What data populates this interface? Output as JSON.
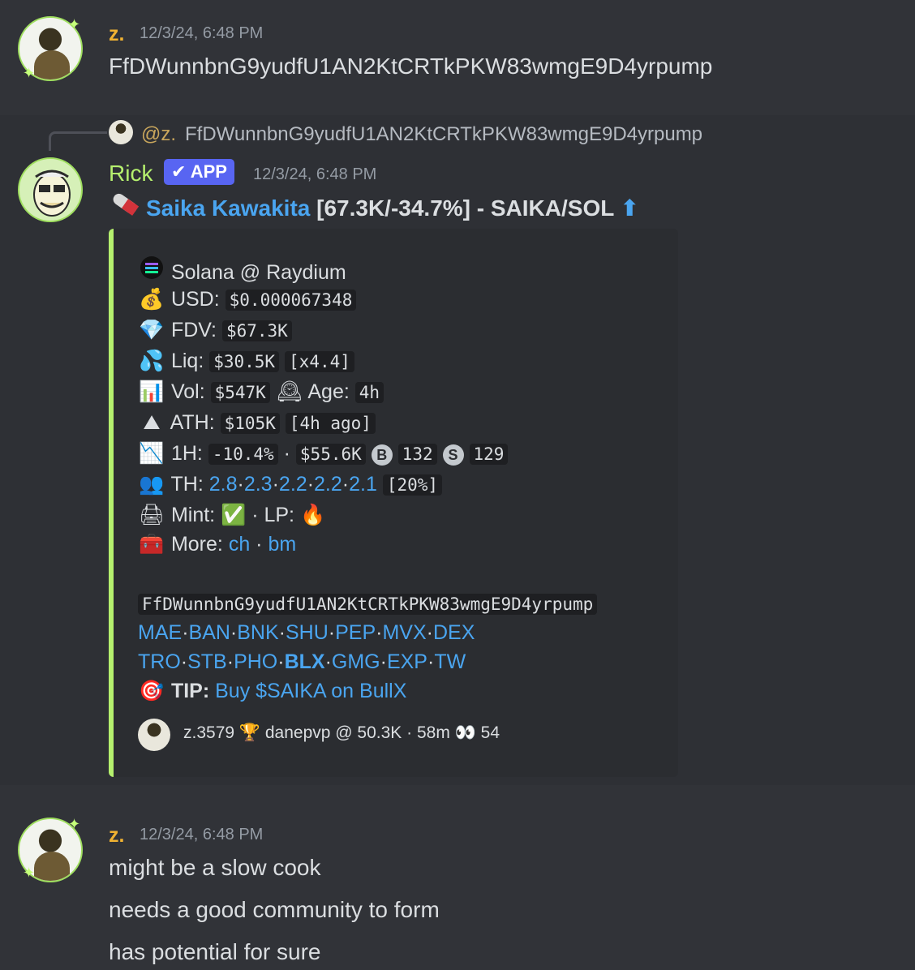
{
  "colors": {
    "z_name": "#f0b232",
    "rick_name": "#b5f06e",
    "link": "#4aa5f0",
    "embed_bar": "#b5f06e",
    "app_badge": "#5865f2"
  },
  "msg1": {
    "username": "z.",
    "timestamp": "12/3/24, 6:48 PM",
    "text": "FfDWunnbnG9yudfU1AN2KtCRTkPKW83wmgE9D4yrpump"
  },
  "reply": {
    "mention": "@z.",
    "text": "FfDWunnbnG9yudfU1AN2KtCRTkPKW83wmgE9D4yrpump"
  },
  "rick": {
    "username": "Rick",
    "badge": "✔ APP",
    "timestamp": "12/3/24, 6:48 PM",
    "headline": {
      "pill_icon": "pill-icon",
      "token_name": "Saika Kawakita",
      "rest": " [67.3K/-34.7%] - SAIKA/SOL ",
      "arrow": "⬆"
    },
    "embed": {
      "chain": "Solana @ Raydium",
      "usd_label": "USD:",
      "usd_value": "$0.000067348",
      "fdv_label": "FDV:",
      "fdv_value": "$67.3K",
      "liq_label": "Liq:",
      "liq_value": "$30.5K",
      "liq_mult": "[x4.4]",
      "vol_label": "Vol:",
      "vol_value": "$547K",
      "age_label": "Age:",
      "age_value": "4h",
      "ath_label": "ATH:",
      "ath_value": "$105K",
      "ath_ago": "[4h ago]",
      "h1_label": "1H:",
      "h1_change": "-10.4%",
      "h1_vol": "$55.6K",
      "buy_icon": "B",
      "buys": "132",
      "sell_icon": "S",
      "sells": "129",
      "th_label": "TH:",
      "th_values": [
        "2.8",
        "2.3",
        "2.2",
        "2.2",
        "2.1"
      ],
      "th_pct": "[20%]",
      "mint_label": "Mint:",
      "mint_icon": "✅",
      "lp_label": "LP:",
      "lp_icon": "🔥",
      "more_label": "More:",
      "more_links": [
        "ch",
        "bm"
      ],
      "contract": "FfDWunnbnG9yudfU1AN2KtCRTkPKW83wmgE9D4yrpump",
      "links_row1": [
        "MAE",
        "BAN",
        "BNK",
        "SHU",
        "PEP",
        "MVX",
        "DEX"
      ],
      "links_row2": [
        "TRO",
        "STB",
        "PHO",
        "BLX",
        "GMG",
        "EXP",
        "TW"
      ],
      "tip_label": "TIP:",
      "tip_text": "Buy $SAIKA on BullX",
      "footer": "z.3579 🏆 danepvp @ 50.3K · 58m 👀 54"
    }
  },
  "msg3": {
    "username": "z.",
    "timestamp": "12/3/24, 6:48 PM",
    "lines": [
      "might be a slow cook",
      "needs a good community to form",
      "has potential for sure"
    ]
  }
}
